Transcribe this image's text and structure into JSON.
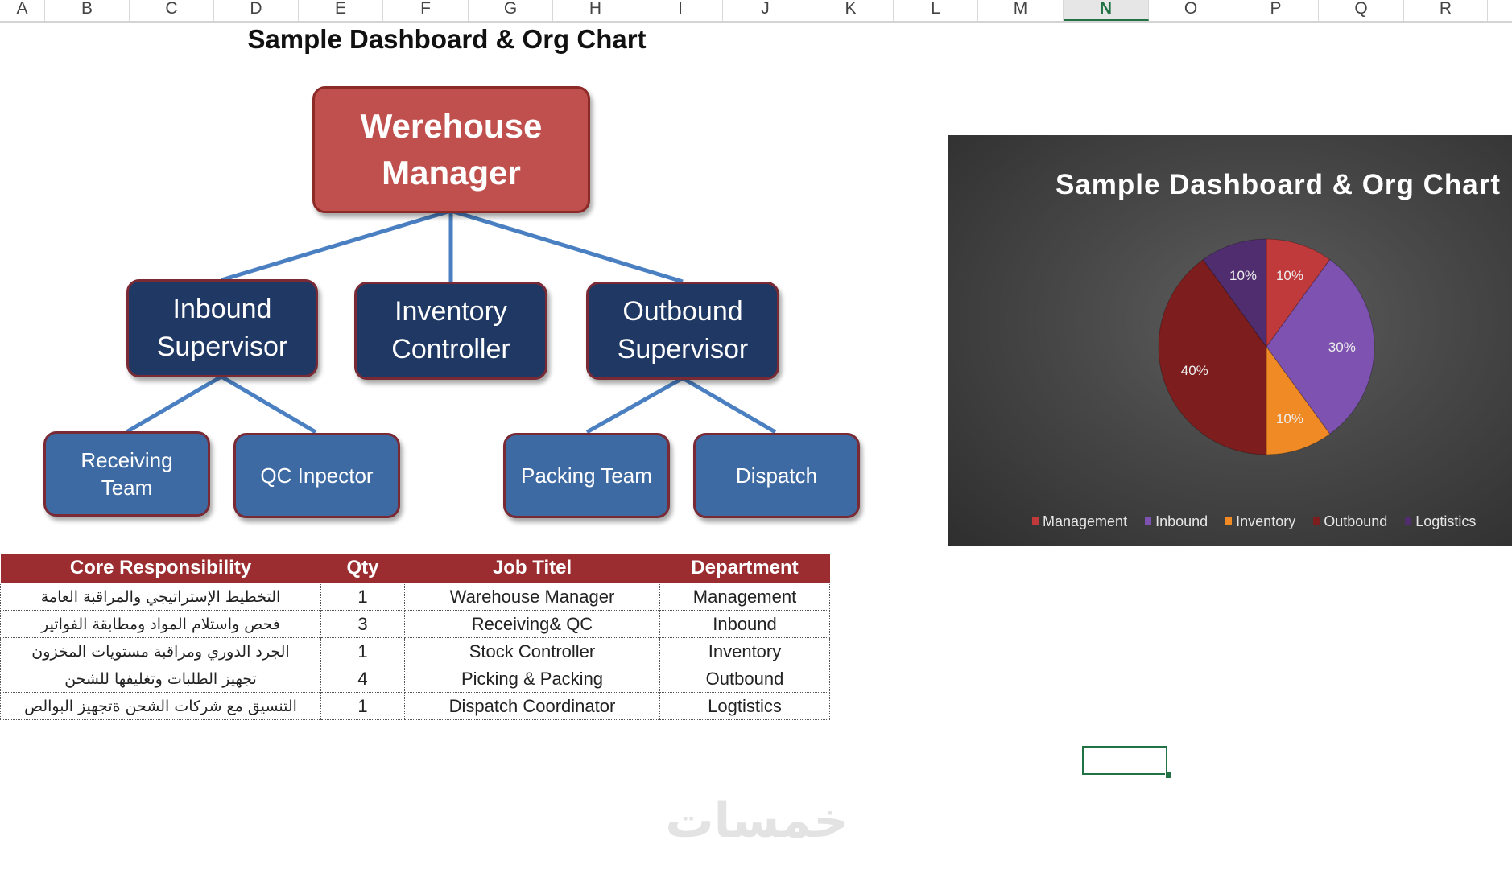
{
  "sheet": {
    "columns": [
      "A",
      "B",
      "C",
      "D",
      "E",
      "F",
      "G",
      "H",
      "I",
      "J",
      "K",
      "L",
      "M",
      "N",
      "O",
      "P",
      "Q",
      "R"
    ],
    "selected_column": "N",
    "title": "Sample Dashboard & Org Chart"
  },
  "org_chart": {
    "manager": "Werehouse\nManager",
    "supervisors": [
      "Inbound\nSupervisor",
      "Inventory\nController",
      "Outbound\nSupervisor"
    ],
    "teams": [
      "Receiving\nTeam",
      "QC Inpector",
      "Packing Team",
      "Dispatch"
    ],
    "colors": {
      "manager": "#c0504d",
      "supervisor": "#1f3864",
      "team": "#3e6aa3",
      "connector": "#4a7fc1"
    }
  },
  "table": {
    "headers": [
      "Core Responsibility",
      "Qty",
      "Job Titel",
      "Department"
    ],
    "rows": [
      [
        "التخطيط الإستراتيجي والمراقبة العامة",
        "1",
        "Warehouse Manager",
        "Management"
      ],
      [
        "فحص واستلام المواد ومطابقة الفواتير",
        "3",
        "Receiving& QC",
        "Inbound"
      ],
      [
        "الجرد الدوري ومراقبة مستويات المخزون",
        "1",
        "Stock Controller",
        "Inventory"
      ],
      [
        "تجهيز الطلبات وتغليفها للشحن",
        "4",
        "Picking & Packing",
        "Outbound"
      ],
      [
        "التنسيق مع شركات الشحن ةتجهيز البوالص",
        "1",
        "Dispatch Coordinator",
        "Logtistics"
      ]
    ]
  },
  "chart_data": {
    "type": "pie",
    "title": "Sample Dashboard & Org Chart",
    "categories": [
      "Management",
      "Inbound",
      "Inventory",
      "Outbound",
      "Logtistics"
    ],
    "values": [
      10,
      30,
      10,
      40,
      10
    ],
    "labels": [
      "10%",
      "30%",
      "10%",
      "40%",
      "10%"
    ],
    "colors": [
      "#c0393b",
      "#7d52b0",
      "#f08a24",
      "#7e1d1d",
      "#4f2d6e"
    ],
    "legend_position": "bottom",
    "start_angle_deg": 0
  },
  "watermark": "خمسات"
}
